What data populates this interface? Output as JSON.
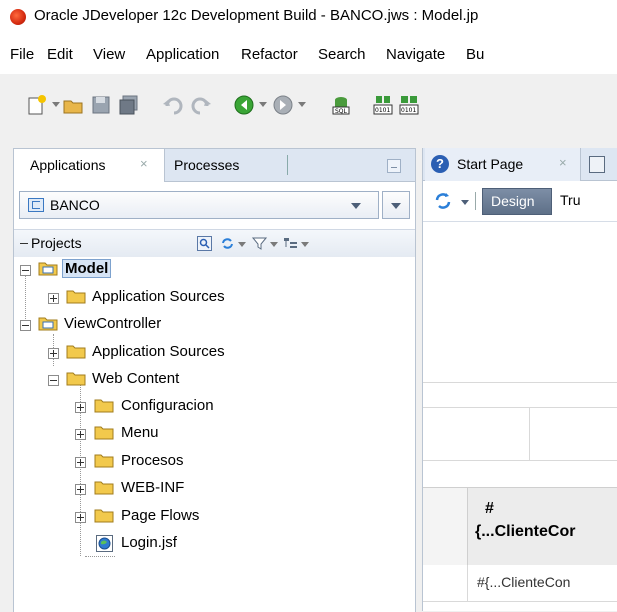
{
  "window": {
    "title": "Oracle JDeveloper 12c Development Build - BANCO.jws : Model.jp"
  },
  "menubar": {
    "items": [
      "File",
      "Edit",
      "View",
      "Application",
      "Refactor",
      "Search",
      "Navigate",
      "Bu"
    ]
  },
  "toolbar": {
    "icons": [
      "new-file-icon",
      "open-folder-icon",
      "save-icon",
      "save-all-icon",
      "undo-icon",
      "redo-icon",
      "back-icon",
      "forward-icon",
      "sql-icon",
      "make-icon",
      "rebuild-icon"
    ]
  },
  "left_panel": {
    "tabs": [
      {
        "label": "Applications",
        "close": "×",
        "active": true
      },
      {
        "label": "Processes",
        "active": false
      }
    ],
    "application_selector": {
      "value": "BANCO"
    },
    "projects_label": "Projects",
    "tree": [
      {
        "label": "Model",
        "level": 0,
        "expanded": true,
        "icon": "project-folder-icon",
        "selected": true
      },
      {
        "label": "Application Sources",
        "level": 1,
        "expanded": false,
        "icon": "folder-icon"
      },
      {
        "label": "ViewController",
        "level": 0,
        "expanded": true,
        "icon": "project-folder-icon"
      },
      {
        "label": "Application Sources",
        "level": 1,
        "expanded": false,
        "icon": "folder-icon"
      },
      {
        "label": "Web Content",
        "level": 1,
        "expanded": true,
        "icon": "folder-icon"
      },
      {
        "label": "Configuracion",
        "level": 2,
        "expanded": false,
        "icon": "folder-icon"
      },
      {
        "label": "Menu",
        "level": 2,
        "expanded": false,
        "icon": "folder-icon"
      },
      {
        "label": "Procesos",
        "level": 2,
        "expanded": false,
        "icon": "folder-icon"
      },
      {
        "label": "WEB-INF",
        "level": 2,
        "expanded": false,
        "icon": "folder-icon"
      },
      {
        "label": "Page Flows",
        "level": 2,
        "expanded": false,
        "icon": "folder-icon"
      },
      {
        "label": "Login.jsf",
        "level": 2,
        "leaf": true,
        "icon": "jsf-page-icon"
      }
    ]
  },
  "editor": {
    "tabs": [
      {
        "label": "Start Page",
        "close": "×",
        "icon": "help-icon"
      }
    ],
    "mode_buttons": {
      "design": "Design",
      "truncated": "Tru"
    },
    "table": {
      "header_line1": "#",
      "header_line2": "{...ClienteCor",
      "row_cell": "#{...ClienteCon"
    }
  },
  "colors": {
    "selection_bg": "#d6e4f5",
    "folder_yellow": "#f2c94c",
    "tab_bar": "#dde6f2",
    "design_button": "#6b7c94"
  }
}
